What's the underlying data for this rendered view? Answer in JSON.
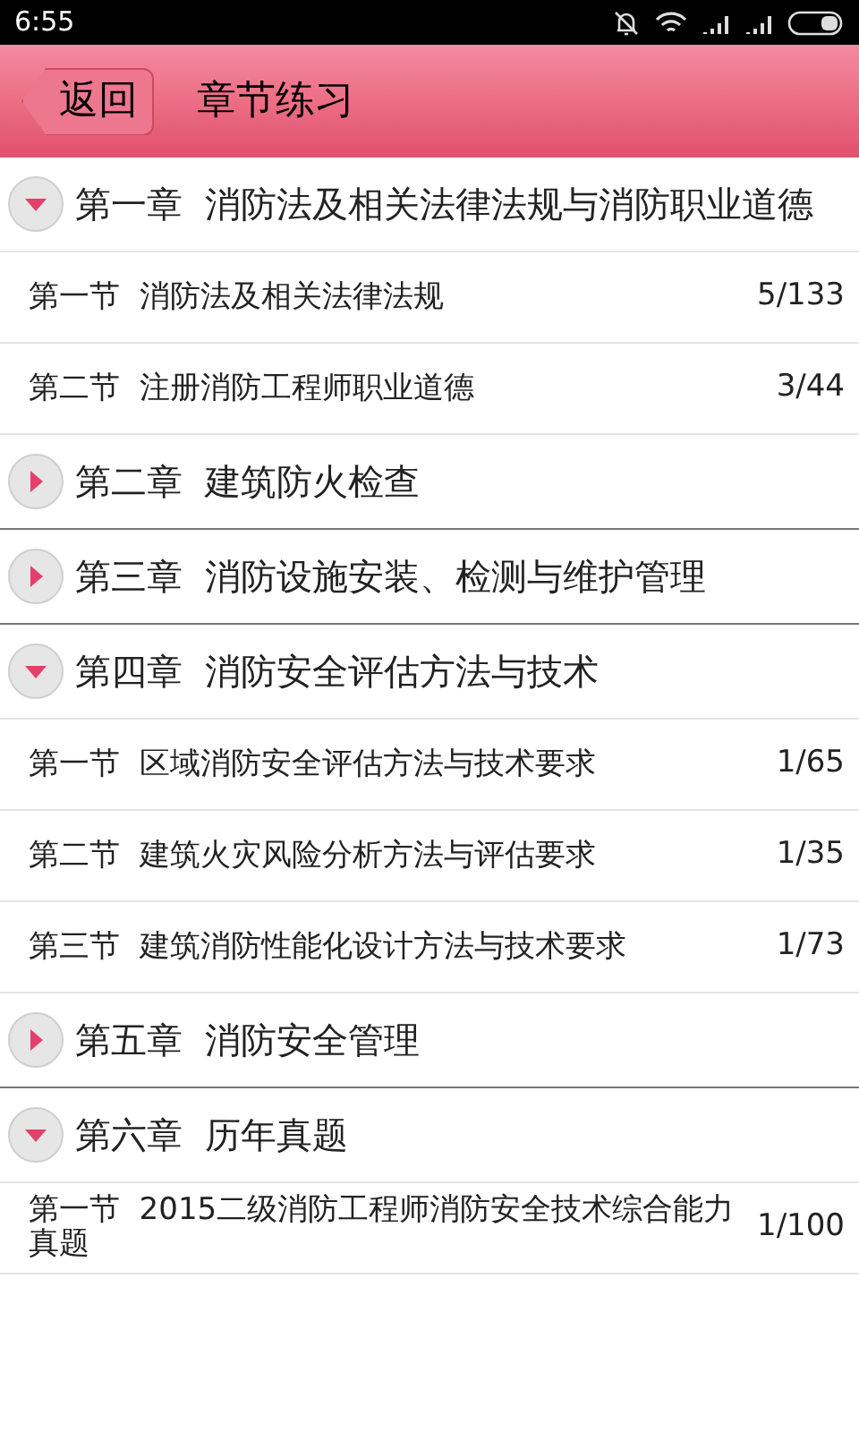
{
  "status_bar": {
    "time": "6:55"
  },
  "header": {
    "back": "返回",
    "title": "章节练习"
  },
  "chapters": [
    {
      "title": "第一章  消防法及相关法律法规与消防职业道德",
      "expanded": true,
      "children": [
        {
          "title": "第一节  消防法及相关法律法规",
          "progress": "5/133"
        },
        {
          "title": "第二节  注册消防工程师职业道德",
          "progress": "3/44"
        }
      ]
    },
    {
      "title": "第二章  建筑防火检查",
      "expanded": false
    },
    {
      "title": "第三章  消防设施安装、检测与维护管理",
      "expanded": false
    },
    {
      "title": "第四章  消防安全评估方法与技术",
      "expanded": true,
      "children": [
        {
          "title": "第一节  区域消防安全评估方法与技术要求",
          "progress": "1/65"
        },
        {
          "title": "第二节  建筑火灾风险分析方法与评估要求",
          "progress": "1/35"
        },
        {
          "title": "第三节  建筑消防性能化设计方法与技术要求",
          "progress": "1/73"
        }
      ]
    },
    {
      "title": "第五章  消防安全管理",
      "expanded": false
    },
    {
      "title": "第六章  历年真题",
      "expanded": true,
      "children": [
        {
          "title": "第一节  2015二级消防工程师消防安全技术综合能力真题",
          "progress": "1/100"
        }
      ]
    }
  ]
}
